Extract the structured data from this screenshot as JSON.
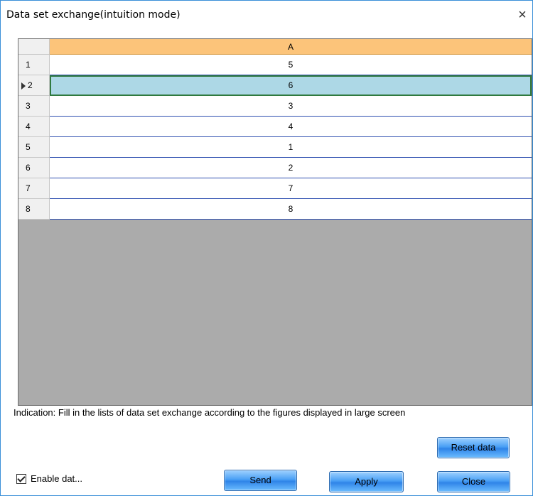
{
  "window": {
    "title": "Data set exchange(intuition mode)",
    "close_glyph": "×"
  },
  "grid": {
    "column_header": "A",
    "selected_row_index": 1,
    "rows": [
      {
        "num": "1",
        "value": "5"
      },
      {
        "num": "2",
        "value": "6"
      },
      {
        "num": "3",
        "value": "3"
      },
      {
        "num": "4",
        "value": "4"
      },
      {
        "num": "5",
        "value": "1"
      },
      {
        "num": "6",
        "value": "2"
      },
      {
        "num": "7",
        "value": "7"
      },
      {
        "num": "8",
        "value": "8"
      }
    ]
  },
  "indication": "Indication: Fill in the lists of data set exchange according to the figures displayed in large screen",
  "buttons": {
    "reset": "Reset data",
    "send": "Send",
    "apply": "Apply",
    "close": "Close"
  },
  "enable_checkbox": {
    "label": "Enable dat...",
    "checked": true
  },
  "colors": {
    "column_header_bg": "#fcc47a",
    "selected_cell_bg": "#add8e6",
    "selected_cell_border": "#2f7a3f",
    "grid_empty_bg": "#ababab",
    "button_blue": "#4aa0f5"
  }
}
